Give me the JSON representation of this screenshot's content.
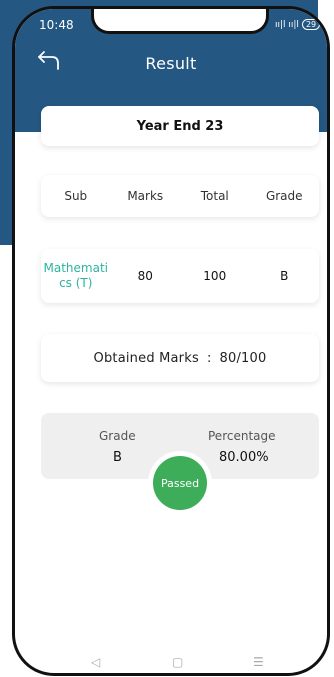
{
  "status_bar": {
    "time": "10:48",
    "signal": "ıı|l ıı|l",
    "battery": "29"
  },
  "header": {
    "title": "Result"
  },
  "exam": {
    "name": "Year End 23"
  },
  "table": {
    "headers": [
      "Sub",
      "Marks",
      "Total",
      "Grade"
    ],
    "rows": [
      {
        "subject_line1": "Mathemati",
        "subject_line2": "cs (T)",
        "marks": "80",
        "total": "100",
        "grade": "B"
      }
    ]
  },
  "obtained": {
    "label": "Obtained Marks",
    "separator": ":",
    "value": "80/100"
  },
  "summary": {
    "grade_label": "Grade",
    "grade_value": "B",
    "percentage_label": "Percentage",
    "percentage_value": "80.00%",
    "status": "Passed"
  },
  "nav": {
    "back": "◁",
    "home": "▢",
    "menu": "☰"
  },
  "colors": {
    "header_bg": "#245782",
    "subject_text": "#2bb5a0",
    "passed_badge": "#3dad5a"
  }
}
